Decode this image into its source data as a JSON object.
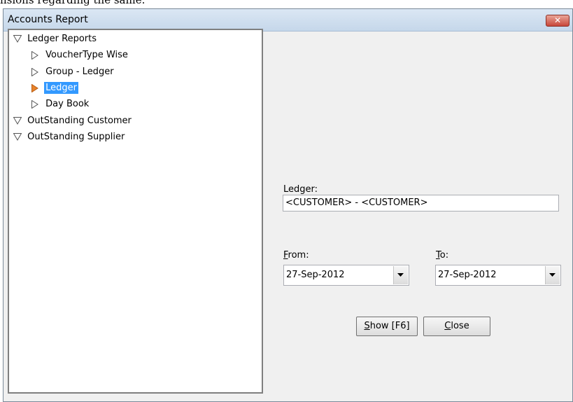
{
  "background": {
    "text": "nsions regarding the same."
  },
  "window": {
    "title": "Accounts Report",
    "close_glyph": "✕"
  },
  "tree": {
    "groups": [
      {
        "label": "Ledger Reports",
        "expanded": true,
        "children": [
          "VoucherType Wise",
          "Group - Ledger",
          "Ledger",
          "Day Book"
        ]
      },
      {
        "label": "OutStanding Customer",
        "expanded": true,
        "children": []
      },
      {
        "label": "OutStanding Supplier",
        "expanded": true,
        "children": []
      }
    ],
    "selected": "Ledger"
  },
  "form": {
    "ledger_label": "Ledger:",
    "ledger_value": "<CUSTOMER> - <CUSTOMER>",
    "from_label_accel": "F",
    "from_label_rest": "rom:",
    "to_label_accel": "T",
    "to_label_rest": "o:",
    "from_value": "27-Sep-2012",
    "to_value": "27-Sep-2012"
  },
  "buttons": {
    "show_accel": "S",
    "show_rest": "how [F6]",
    "close_accel": "C",
    "close_rest": "lose"
  },
  "colors": {
    "selection": "#3399ff",
    "selected_arrow": "#e8832a",
    "close_button": "#c8473a"
  }
}
